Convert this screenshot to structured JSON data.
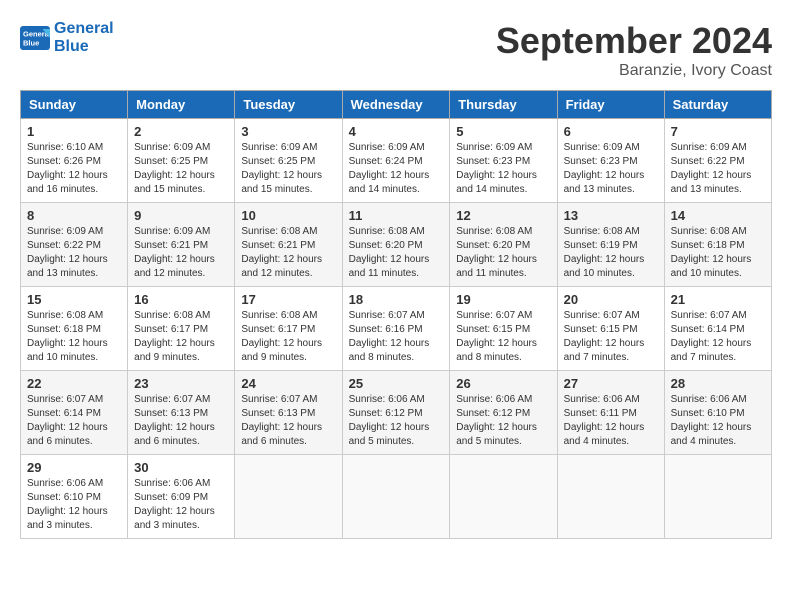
{
  "header": {
    "logo_line1": "General",
    "logo_line2": "Blue",
    "month_title": "September 2024",
    "location": "Baranzie, Ivory Coast"
  },
  "columns": [
    "Sunday",
    "Monday",
    "Tuesday",
    "Wednesday",
    "Thursday",
    "Friday",
    "Saturday"
  ],
  "weeks": [
    [
      {
        "day": "1",
        "sunrise": "Sunrise: 6:10 AM",
        "sunset": "Sunset: 6:26 PM",
        "daylight": "Daylight: 12 hours and 16 minutes."
      },
      {
        "day": "2",
        "sunrise": "Sunrise: 6:09 AM",
        "sunset": "Sunset: 6:25 PM",
        "daylight": "Daylight: 12 hours and 15 minutes."
      },
      {
        "day": "3",
        "sunrise": "Sunrise: 6:09 AM",
        "sunset": "Sunset: 6:25 PM",
        "daylight": "Daylight: 12 hours and 15 minutes."
      },
      {
        "day": "4",
        "sunrise": "Sunrise: 6:09 AM",
        "sunset": "Sunset: 6:24 PM",
        "daylight": "Daylight: 12 hours and 14 minutes."
      },
      {
        "day": "5",
        "sunrise": "Sunrise: 6:09 AM",
        "sunset": "Sunset: 6:23 PM",
        "daylight": "Daylight: 12 hours and 14 minutes."
      },
      {
        "day": "6",
        "sunrise": "Sunrise: 6:09 AM",
        "sunset": "Sunset: 6:23 PM",
        "daylight": "Daylight: 12 hours and 13 minutes."
      },
      {
        "day": "7",
        "sunrise": "Sunrise: 6:09 AM",
        "sunset": "Sunset: 6:22 PM",
        "daylight": "Daylight: 12 hours and 13 minutes."
      }
    ],
    [
      {
        "day": "8",
        "sunrise": "Sunrise: 6:09 AM",
        "sunset": "Sunset: 6:22 PM",
        "daylight": "Daylight: 12 hours and 13 minutes."
      },
      {
        "day": "9",
        "sunrise": "Sunrise: 6:09 AM",
        "sunset": "Sunset: 6:21 PM",
        "daylight": "Daylight: 12 hours and 12 minutes."
      },
      {
        "day": "10",
        "sunrise": "Sunrise: 6:08 AM",
        "sunset": "Sunset: 6:21 PM",
        "daylight": "Daylight: 12 hours and 12 minutes."
      },
      {
        "day": "11",
        "sunrise": "Sunrise: 6:08 AM",
        "sunset": "Sunset: 6:20 PM",
        "daylight": "Daylight: 12 hours and 11 minutes."
      },
      {
        "day": "12",
        "sunrise": "Sunrise: 6:08 AM",
        "sunset": "Sunset: 6:20 PM",
        "daylight": "Daylight: 12 hours and 11 minutes."
      },
      {
        "day": "13",
        "sunrise": "Sunrise: 6:08 AM",
        "sunset": "Sunset: 6:19 PM",
        "daylight": "Daylight: 12 hours and 10 minutes."
      },
      {
        "day": "14",
        "sunrise": "Sunrise: 6:08 AM",
        "sunset": "Sunset: 6:18 PM",
        "daylight": "Daylight: 12 hours and 10 minutes."
      }
    ],
    [
      {
        "day": "15",
        "sunrise": "Sunrise: 6:08 AM",
        "sunset": "Sunset: 6:18 PM",
        "daylight": "Daylight: 12 hours and 10 minutes."
      },
      {
        "day": "16",
        "sunrise": "Sunrise: 6:08 AM",
        "sunset": "Sunset: 6:17 PM",
        "daylight": "Daylight: 12 hours and 9 minutes."
      },
      {
        "day": "17",
        "sunrise": "Sunrise: 6:08 AM",
        "sunset": "Sunset: 6:17 PM",
        "daylight": "Daylight: 12 hours and 9 minutes."
      },
      {
        "day": "18",
        "sunrise": "Sunrise: 6:07 AM",
        "sunset": "Sunset: 6:16 PM",
        "daylight": "Daylight: 12 hours and 8 minutes."
      },
      {
        "day": "19",
        "sunrise": "Sunrise: 6:07 AM",
        "sunset": "Sunset: 6:15 PM",
        "daylight": "Daylight: 12 hours and 8 minutes."
      },
      {
        "day": "20",
        "sunrise": "Sunrise: 6:07 AM",
        "sunset": "Sunset: 6:15 PM",
        "daylight": "Daylight: 12 hours and 7 minutes."
      },
      {
        "day": "21",
        "sunrise": "Sunrise: 6:07 AM",
        "sunset": "Sunset: 6:14 PM",
        "daylight": "Daylight: 12 hours and 7 minutes."
      }
    ],
    [
      {
        "day": "22",
        "sunrise": "Sunrise: 6:07 AM",
        "sunset": "Sunset: 6:14 PM",
        "daylight": "Daylight: 12 hours and 6 minutes."
      },
      {
        "day": "23",
        "sunrise": "Sunrise: 6:07 AM",
        "sunset": "Sunset: 6:13 PM",
        "daylight": "Daylight: 12 hours and 6 minutes."
      },
      {
        "day": "24",
        "sunrise": "Sunrise: 6:07 AM",
        "sunset": "Sunset: 6:13 PM",
        "daylight": "Daylight: 12 hours and 6 minutes."
      },
      {
        "day": "25",
        "sunrise": "Sunrise: 6:06 AM",
        "sunset": "Sunset: 6:12 PM",
        "daylight": "Daylight: 12 hours and 5 minutes."
      },
      {
        "day": "26",
        "sunrise": "Sunrise: 6:06 AM",
        "sunset": "Sunset: 6:12 PM",
        "daylight": "Daylight: 12 hours and 5 minutes."
      },
      {
        "day": "27",
        "sunrise": "Sunrise: 6:06 AM",
        "sunset": "Sunset: 6:11 PM",
        "daylight": "Daylight: 12 hours and 4 minutes."
      },
      {
        "day": "28",
        "sunrise": "Sunrise: 6:06 AM",
        "sunset": "Sunset: 6:10 PM",
        "daylight": "Daylight: 12 hours and 4 minutes."
      }
    ],
    [
      {
        "day": "29",
        "sunrise": "Sunrise: 6:06 AM",
        "sunset": "Sunset: 6:10 PM",
        "daylight": "Daylight: 12 hours and 3 minutes."
      },
      {
        "day": "30",
        "sunrise": "Sunrise: 6:06 AM",
        "sunset": "Sunset: 6:09 PM",
        "daylight": "Daylight: 12 hours and 3 minutes."
      },
      null,
      null,
      null,
      null,
      null
    ]
  ]
}
